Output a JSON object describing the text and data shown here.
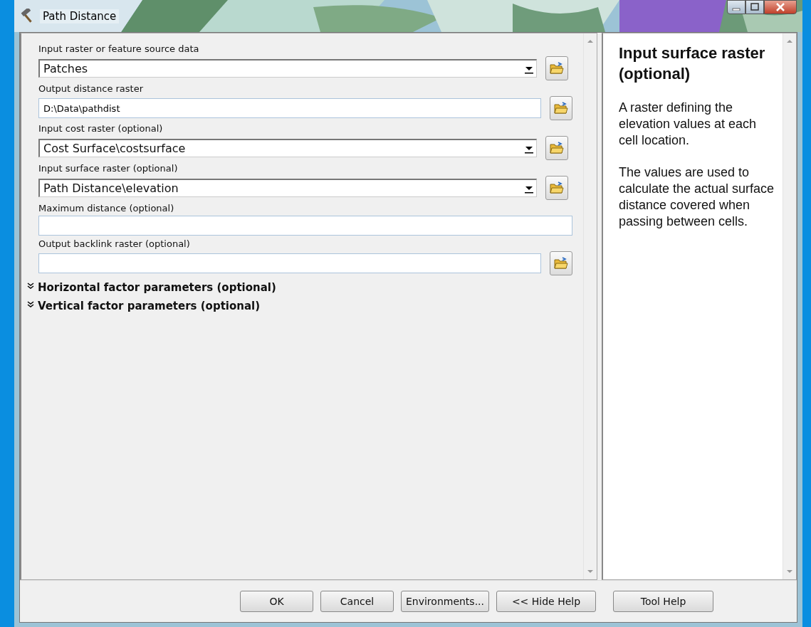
{
  "window": {
    "title": "Path Distance"
  },
  "fields": [
    {
      "kind": "dropdown",
      "label": "Input raster or feature source data",
      "value": "Patches",
      "browse": true
    },
    {
      "kind": "text",
      "label": "Output distance raster",
      "value": "D:\\Data\\pathdist",
      "browse": true
    },
    {
      "kind": "dropdown",
      "label": "Input cost raster (optional)",
      "value": "Cost Surface\\costsurface",
      "browse": true
    },
    {
      "kind": "dropdown",
      "label": "Input surface raster (optional)",
      "value": "Path Distance\\elevation",
      "browse": true
    },
    {
      "kind": "text",
      "label": "Maximum distance (optional)",
      "browse": false
    },
    {
      "kind": "text",
      "label": "Output backlink raster (optional)",
      "browse": true
    }
  ],
  "sections": [
    {
      "label": "Horizontal factor parameters (optional)",
      "expanded": false
    },
    {
      "label": "Vertical factor parameters (optional)",
      "expanded": false
    }
  ],
  "help": {
    "title": "Input surface raster (optional)",
    "paragraphs": [
      "A raster defining the elevation values at each cell location.",
      "The values are used to calculate the actual surface distance covered when passing between cells."
    ]
  },
  "buttons": [
    "OK",
    "Cancel",
    "Environments...",
    "<< Hide Help",
    "Tool Help"
  ]
}
